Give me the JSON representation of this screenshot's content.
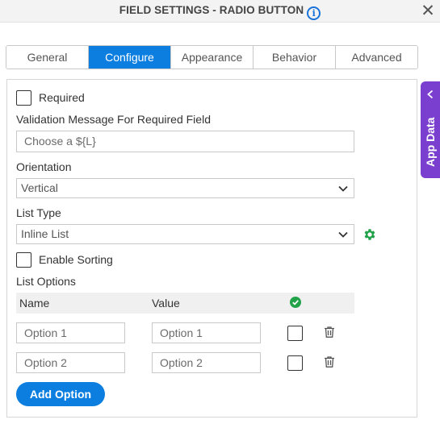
{
  "dialog": {
    "title": "FIELD SETTINGS - RADIO BUTTON",
    "close_symbol": "✕"
  },
  "tabs": [
    {
      "label": "General",
      "active": false
    },
    {
      "label": "Configure",
      "active": true
    },
    {
      "label": "Appearance",
      "active": false
    },
    {
      "label": "Behavior",
      "active": false
    },
    {
      "label": "Advanced",
      "active": false
    }
  ],
  "configure": {
    "required_label": "Required",
    "required_checked": false,
    "validation_label": "Validation Message For Required Field",
    "validation_value": "Choose a ${L}",
    "orientation_label": "Orientation",
    "orientation_value": "Vertical",
    "list_type_label": "List Type",
    "list_type_value": "Inline List",
    "enable_sorting_label": "Enable Sorting",
    "enable_sorting_checked": false,
    "list_options_label": "List Options",
    "columns": {
      "name": "Name",
      "value": "Value"
    },
    "options": [
      {
        "name": "Option 1",
        "value": "Option 1",
        "default": false
      },
      {
        "name": "Option 2",
        "value": "Option 2",
        "default": false
      }
    ],
    "add_option_label": "Add Option"
  },
  "side_panel": {
    "label": "App Data"
  },
  "colors": {
    "accent": "#0b7ee0",
    "side_panel": "#7b3fd0",
    "success": "#22a34a"
  }
}
